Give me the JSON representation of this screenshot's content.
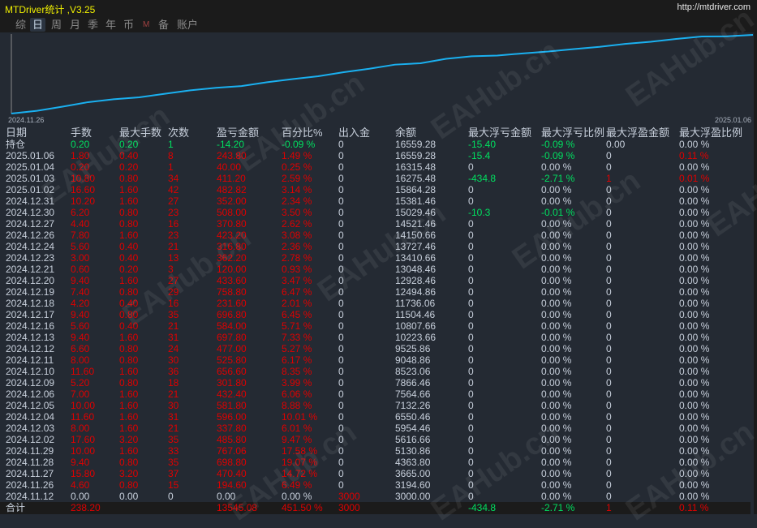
{
  "window": {
    "title": "MTDriver统计 ,V3.25",
    "url": "http://mtdriver.com"
  },
  "tabs": [
    {
      "label": "综"
    },
    {
      "label": "日",
      "active": true
    },
    {
      "label": "周"
    },
    {
      "label": "月"
    },
    {
      "label": "季"
    },
    {
      "label": "年"
    },
    {
      "label": "币"
    },
    {
      "label": "M"
    },
    {
      "label": "备"
    },
    {
      "label": "账户"
    }
  ],
  "watermark": "EAHub.cn",
  "chart_data": {
    "type": "line",
    "title": "",
    "x_start_label": "2024.11.26",
    "x_end_label": "2025.01.06",
    "series": [
      {
        "name": "余额",
        "color": "#1ab0f0",
        "x": [
          "2024.11.12",
          "2024.11.26",
          "2024.11.27",
          "2024.11.28",
          "2024.11.29",
          "2024.12.02",
          "2024.12.03",
          "2024.12.04",
          "2024.12.05",
          "2024.12.06",
          "2024.12.09",
          "2024.12.10",
          "2024.12.11",
          "2024.12.12",
          "2024.12.13",
          "2024.12.16",
          "2024.12.17",
          "2024.12.18",
          "2024.12.19",
          "2024.12.20",
          "2024.12.21",
          "2024.12.23",
          "2024.12.24",
          "2024.12.26",
          "2024.12.27",
          "2024.12.30",
          "2024.12.31",
          "2025.01.02",
          "2025.01.03",
          "2025.01.04",
          "2025.01.06"
        ],
        "values": [
          3000.0,
          3194.6,
          3665.0,
          4363.8,
          5130.86,
          5616.66,
          5954.46,
          6550.46,
          7132.26,
          7564.66,
          7866.46,
          8523.06,
          9048.86,
          9525.86,
          10223.66,
          10807.66,
          11504.46,
          11736.06,
          12494.86,
          12928.46,
          13048.46,
          13410.66,
          13727.46,
          14150.66,
          14521.46,
          15029.46,
          15381.46,
          15864.28,
          16275.48,
          16315.48,
          16559.28
        ]
      }
    ]
  },
  "table": {
    "headers": [
      "日期",
      "手数",
      "最大手数",
      "次数",
      "盈亏金额",
      "百分比%",
      "出入金",
      "余额",
      "最大浮亏金额",
      "最大浮亏比例",
      "最大浮盈金额",
      "最大浮盈比例"
    ],
    "position": [
      "持仓",
      "0.20",
      "0.20",
      "1",
      "-14.20",
      "-0.09 %",
      "0",
      "16559.28",
      "-15.40",
      "-0.09 %",
      "0.00",
      "0.00 %"
    ],
    "rows": [
      [
        "2025.01.06",
        "1.80",
        "0.40",
        "8",
        "243.80",
        "1.49 %",
        "0",
        "16559.28",
        "-15.4",
        "-0.09 %",
        "0",
        "0.11 %"
      ],
      [
        "2025.01.04",
        "0.20",
        "0.20",
        "1",
        "40.00",
        "0.25 %",
        "0",
        "16315.48",
        "0",
        "0.00 %",
        "0",
        "0.00 %"
      ],
      [
        "2025.01.03",
        "10.80",
        "0.80",
        "34",
        "411.20",
        "2.59 %",
        "0",
        "16275.48",
        "-434.8",
        "-2.71 %",
        "1",
        "0.01 %"
      ],
      [
        "2025.01.02",
        "16.60",
        "1.60",
        "42",
        "482.82",
        "3.14 %",
        "0",
        "15864.28",
        "0",
        "0.00 %",
        "0",
        "0.00 %"
      ],
      [
        "2024.12.31",
        "10.20",
        "1.60",
        "27",
        "352.00",
        "2.34 %",
        "0",
        "15381.46",
        "0",
        "0.00 %",
        "0",
        "0.00 %"
      ],
      [
        "2024.12.30",
        "6.20",
        "0.80",
        "23",
        "508.00",
        "3.50 %",
        "0",
        "15029.46",
        "-10.3",
        "-0.01 %",
        "0",
        "0.00 %"
      ],
      [
        "2024.12.27",
        "4.40",
        "0.80",
        "16",
        "370.80",
        "2.62 %",
        "0",
        "14521.46",
        "0",
        "0.00 %",
        "0",
        "0.00 %"
      ],
      [
        "2024.12.26",
        "7.80",
        "1.60",
        "23",
        "423.20",
        "3.08 %",
        "0",
        "14150.66",
        "0",
        "0.00 %",
        "0",
        "0.00 %"
      ],
      [
        "2024.12.24",
        "5.60",
        "0.40",
        "21",
        "316.80",
        "2.36 %",
        "0",
        "13727.46",
        "0",
        "0.00 %",
        "0",
        "0.00 %"
      ],
      [
        "2024.12.23",
        "3.00",
        "0.40",
        "13",
        "362.20",
        "2.78 %",
        "0",
        "13410.66",
        "0",
        "0.00 %",
        "0",
        "0.00 %"
      ],
      [
        "2024.12.21",
        "0.60",
        "0.20",
        "3",
        "120.00",
        "0.93 %",
        "0",
        "13048.46",
        "0",
        "0.00 %",
        "0",
        "0.00 %"
      ],
      [
        "2024.12.20",
        "9.40",
        "1.60",
        "27",
        "433.60",
        "3.47 %",
        "0",
        "12928.46",
        "0",
        "0.00 %",
        "0",
        "0.00 %"
      ],
      [
        "2024.12.19",
        "7.40",
        "0.80",
        "29",
        "758.80",
        "6.47 %",
        "0",
        "12494.86",
        "0",
        "0.00 %",
        "0",
        "0.00 %"
      ],
      [
        "2024.12.18",
        "4.20",
        "0.40",
        "16",
        "231.60",
        "2.01 %",
        "0",
        "11736.06",
        "0",
        "0.00 %",
        "0",
        "0.00 %"
      ],
      [
        "2024.12.17",
        "9.40",
        "0.80",
        "35",
        "696.80",
        "6.45 %",
        "0",
        "11504.46",
        "0",
        "0.00 %",
        "0",
        "0.00 %"
      ],
      [
        "2024.12.16",
        "5.60",
        "0.40",
        "21",
        "584.00",
        "5.71 %",
        "0",
        "10807.66",
        "0",
        "0.00 %",
        "0",
        "0.00 %"
      ],
      [
        "2024.12.13",
        "9.40",
        "1.60",
        "31",
        "697.80",
        "7.33 %",
        "0",
        "10223.66",
        "0",
        "0.00 %",
        "0",
        "0.00 %"
      ],
      [
        "2024.12.12",
        "6.60",
        "0.80",
        "24",
        "477.00",
        "5.27 %",
        "0",
        "9525.86",
        "0",
        "0.00 %",
        "0",
        "0.00 %"
      ],
      [
        "2024.12.11",
        "8.00",
        "0.80",
        "30",
        "525.80",
        "6.17 %",
        "0",
        "9048.86",
        "0",
        "0.00 %",
        "0",
        "0.00 %"
      ],
      [
        "2024.12.10",
        "11.60",
        "1.60",
        "36",
        "656.60",
        "8.35 %",
        "0",
        "8523.06",
        "0",
        "0.00 %",
        "0",
        "0.00 %"
      ],
      [
        "2024.12.09",
        "5.20",
        "0.80",
        "18",
        "301.80",
        "3.99 %",
        "0",
        "7866.46",
        "0",
        "0.00 %",
        "0",
        "0.00 %"
      ],
      [
        "2024.12.06",
        "7.00",
        "1.60",
        "21",
        "432.40",
        "6.06 %",
        "0",
        "7564.66",
        "0",
        "0.00 %",
        "0",
        "0.00 %"
      ],
      [
        "2024.12.05",
        "10.00",
        "1.60",
        "30",
        "581.80",
        "8.88 %",
        "0",
        "7132.26",
        "0",
        "0.00 %",
        "0",
        "0.00 %"
      ],
      [
        "2024.12.04",
        "11.60",
        "1.60",
        "31",
        "596.00",
        "10.01 %",
        "0",
        "6550.46",
        "0",
        "0.00 %",
        "0",
        "0.00 %"
      ],
      [
        "2024.12.03",
        "8.00",
        "1.60",
        "21",
        "337.80",
        "6.01 %",
        "0",
        "5954.46",
        "0",
        "0.00 %",
        "0",
        "0.00 %"
      ],
      [
        "2024.12.02",
        "17.60",
        "3.20",
        "35",
        "485.80",
        "9.47 %",
        "0",
        "5616.66",
        "0",
        "0.00 %",
        "0",
        "0.00 %"
      ],
      [
        "2024.11.29",
        "10.00",
        "1.60",
        "33",
        "767.06",
        "17.58 %",
        "0",
        "5130.86",
        "0",
        "0.00 %",
        "0",
        "0.00 %"
      ],
      [
        "2024.11.28",
        "9.40",
        "0.80",
        "35",
        "698.80",
        "19.07 %",
        "0",
        "4363.80",
        "0",
        "0.00 %",
        "0",
        "0.00 %"
      ],
      [
        "2024.11.27",
        "15.80",
        "3.20",
        "37",
        "470.40",
        "14.72 %",
        "0",
        "3665.00",
        "0",
        "0.00 %",
        "0",
        "0.00 %"
      ],
      [
        "2024.11.26",
        "4.60",
        "0.80",
        "15",
        "194.60",
        "6.49 %",
        "0",
        "3194.60",
        "0",
        "0.00 %",
        "0",
        "0.00 %"
      ],
      [
        "2024.11.12",
        "0.00",
        "0.00",
        "0",
        "0.00",
        "0.00 %",
        "3000",
        "3000.00",
        "0",
        "0.00 %",
        "0",
        "0.00 %"
      ]
    ],
    "total": [
      "合计",
      "238.20",
      "",
      "",
      "13545.08",
      "451.50 %",
      "3000",
      "",
      "-434.8",
      "-2.71 %",
      "1",
      "0.11 %"
    ]
  }
}
